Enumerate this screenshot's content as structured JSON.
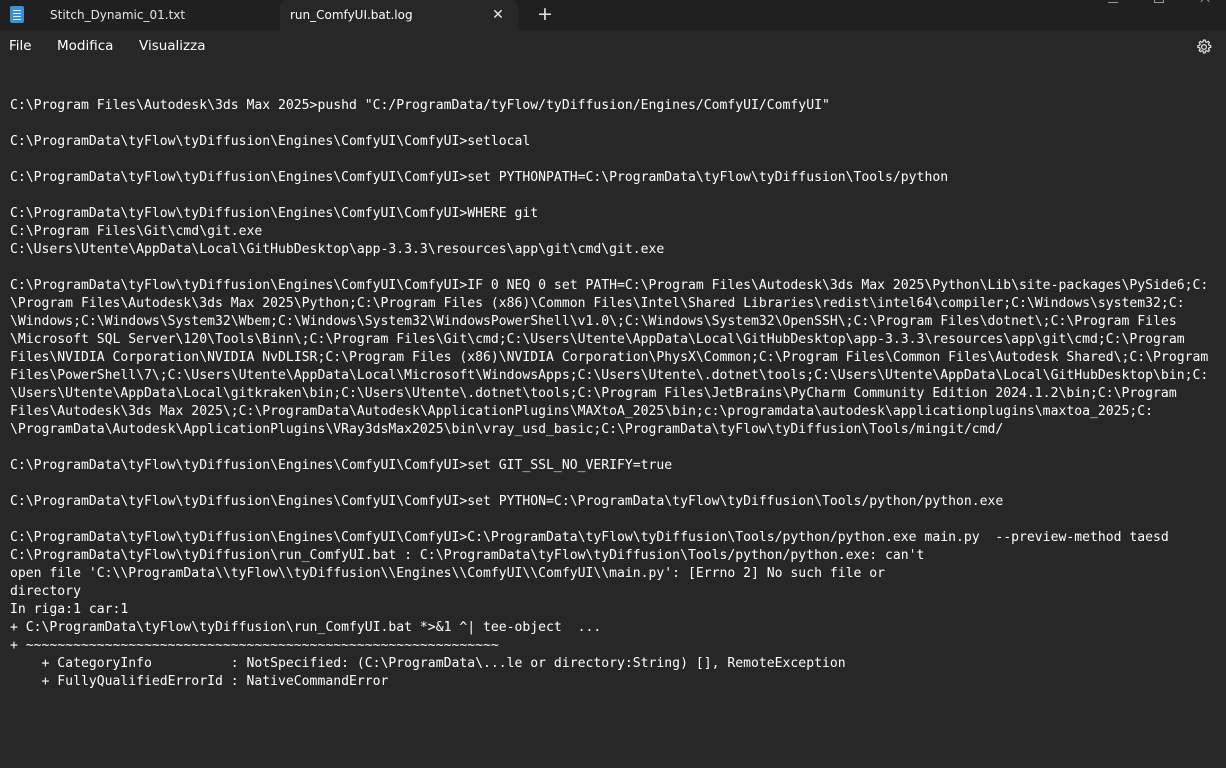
{
  "tabs": [
    {
      "label": "Stitch_Dynamic_01.txt"
    },
    {
      "label": "run_ComfyUI.bat.log"
    }
  ],
  "icons": {
    "app": "notepad-icon",
    "close_tab": "close-icon",
    "new_tab": "plus-icon",
    "settings": "gear-icon"
  },
  "tab_close_glyph": "✕",
  "new_tab_glyph": "+",
  "menu": {
    "file": "File",
    "edit": "Modifica",
    "view": "Visualizza"
  },
  "log_lines": [
    "C:\\Program Files\\Autodesk\\3ds Max 2025>pushd \"C:/ProgramData/tyFlow/tyDiffusion/Engines/ComfyUI/ComfyUI\"",
    "",
    "C:\\ProgramData\\tyFlow\\tyDiffusion\\Engines\\ComfyUI\\ComfyUI>setlocal",
    "",
    "C:\\ProgramData\\tyFlow\\tyDiffusion\\Engines\\ComfyUI\\ComfyUI>set PYTHONPATH=C:\\ProgramData\\tyFlow\\tyDiffusion\\Tools/python",
    "",
    "C:\\ProgramData\\tyFlow\\tyDiffusion\\Engines\\ComfyUI\\ComfyUI>WHERE git",
    "C:\\Program Files\\Git\\cmd\\git.exe",
    "C:\\Users\\Utente\\AppData\\Local\\GitHubDesktop\\app-3.3.3\\resources\\app\\git\\cmd\\git.exe",
    "",
    "C:\\ProgramData\\tyFlow\\tyDiffusion\\Engines\\ComfyUI\\ComfyUI>IF 0 NEQ 0 set PATH=C:\\Program Files\\Autodesk\\3ds Max 2025\\Python\\Lib\\site-packages\\PySide6;C:",
    "\\Program Files\\Autodesk\\3ds Max 2025\\Python;C:\\Program Files (x86)\\Common Files\\Intel\\Shared Libraries\\redist\\intel64\\compiler;C:\\Windows\\system32;C:",
    "\\Windows;C:\\Windows\\System32\\Wbem;C:\\Windows\\System32\\WindowsPowerShell\\v1.0\\;C:\\Windows\\System32\\OpenSSH\\;C:\\Program Files\\dotnet\\;C:\\Program Files",
    "\\Microsoft SQL Server\\120\\Tools\\Binn\\;C:\\Program Files\\Git\\cmd;C:\\Users\\Utente\\AppData\\Local\\GitHubDesktop\\app-3.3.3\\resources\\app\\git\\cmd;C:\\Program",
    "Files\\NVIDIA Corporation\\NVIDIA NvDLISR;C:\\Program Files (x86)\\NVIDIA Corporation\\PhysX\\Common;C:\\Program Files\\Common Files\\Autodesk Shared\\;C:\\Program",
    "Files\\PowerShell\\7\\;C:\\Users\\Utente\\AppData\\Local\\Microsoft\\WindowsApps;C:\\Users\\Utente\\.dotnet\\tools;C:\\Users\\Utente\\AppData\\Local\\GitHubDesktop\\bin;C:",
    "\\Users\\Utente\\AppData\\Local\\gitkraken\\bin;C:\\Users\\Utente\\.dotnet\\tools;C:\\Program Files\\JetBrains\\PyCharm Community Edition 2024.1.2\\bin;C:\\Program",
    "Files\\Autodesk\\3ds Max 2025\\;C:\\ProgramData\\Autodesk\\ApplicationPlugins\\MAXtoA_2025\\bin;c:\\programdata\\autodesk\\applicationplugins\\maxtoa_2025;C:",
    "\\ProgramData\\Autodesk\\ApplicationPlugins\\VRay3dsMax2025\\bin\\vray_usd_basic;C:\\ProgramData\\tyFlow\\tyDiffusion\\Tools/mingit/cmd/",
    "",
    "C:\\ProgramData\\tyFlow\\tyDiffusion\\Engines\\ComfyUI\\ComfyUI>set GIT_SSL_NO_VERIFY=true",
    "",
    "C:\\ProgramData\\tyFlow\\tyDiffusion\\Engines\\ComfyUI\\ComfyUI>set PYTHON=C:\\ProgramData\\tyFlow\\tyDiffusion\\Tools/python/python.exe",
    "",
    "C:\\ProgramData\\tyFlow\\tyDiffusion\\Engines\\ComfyUI\\ComfyUI>C:\\ProgramData\\tyFlow\\tyDiffusion\\Tools/python/python.exe main.py  --preview-method taesd",
    "C:\\ProgramData\\tyFlow\\tyDiffusion\\run_ComfyUI.bat : C:\\ProgramData\\tyFlow\\tyDiffusion\\Tools/python/python.exe: can't",
    "open file 'C:\\\\ProgramData\\\\tyFlow\\\\tyDiffusion\\\\Engines\\\\ComfyUI\\\\ComfyUI\\\\main.py': [Errno 2] No such file or",
    "directory",
    "In riga:1 car:1",
    "+ C:\\ProgramData\\tyFlow\\tyDiffusion\\run_ComfyUI.bat *>&1 ^| tee-object  ...",
    "+ ~~~~~~~~~~~~~~~~~~~~~~~~~~~~~~~~~~~~~~~~~~~~~~~~~~~~~~~~~~~~",
    "    + CategoryInfo          : NotSpecified: (C:\\ProgramData\\...le or directory:String) [], RemoteException",
    "    + FullyQualifiedErrorId : NativeCommandError"
  ]
}
